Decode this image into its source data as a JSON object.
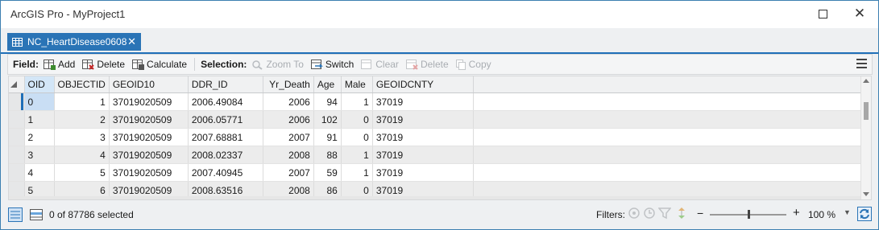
{
  "window": {
    "title": "ArcGIS Pro - MyProject1"
  },
  "tab": {
    "label": "NC_HeartDisease0608"
  },
  "toolbar": {
    "field_label": "Field:",
    "add_label": "Add",
    "delete_label": "Delete",
    "calculate_label": "Calculate",
    "selection_label": "Selection:",
    "zoom_to_label": "Zoom To",
    "switch_label": "Switch",
    "clear_label": "Clear",
    "sel_delete_label": "Delete",
    "copy_label": "Copy"
  },
  "table": {
    "columns": [
      "OID",
      "OBJECTID",
      "GEOID10",
      "DDR_ID",
      "Yr_Death",
      "Age",
      "Male",
      "GEOIDCNTY"
    ],
    "rows": [
      [
        "0",
        "1",
        "37019020509",
        "2006.49084",
        "2006",
        "94",
        "1",
        "37019"
      ],
      [
        "1",
        "2",
        "37019020509",
        "2006.05771",
        "2006",
        "102",
        "0",
        "37019"
      ],
      [
        "2",
        "3",
        "37019020509",
        "2007.68881",
        "2007",
        "91",
        "0",
        "37019"
      ],
      [
        "3",
        "4",
        "37019020509",
        "2008.02337",
        "2008",
        "88",
        "1",
        "37019"
      ],
      [
        "4",
        "5",
        "37019020509",
        "2007.40945",
        "2007",
        "59",
        "1",
        "37019"
      ],
      [
        "5",
        "6",
        "37019020509",
        "2008.63516",
        "2008",
        "86",
        "0",
        "37019"
      ]
    ]
  },
  "status": {
    "selected_text": "0 of 87786 selected",
    "filters_label": "Filters:",
    "zoom_value": "100 %",
    "zoom_fraction": 0.5
  },
  "colors": {
    "accent": "#2a74b6",
    "selected_header": "#d3e6f7"
  }
}
